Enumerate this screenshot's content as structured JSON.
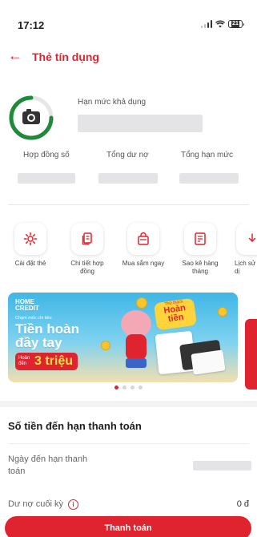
{
  "status": {
    "time": "17:12",
    "battery": "21"
  },
  "header": {
    "title": "Thẻ tín dụng"
  },
  "card_info": {
    "available_limit_label": "Hạn mức khả dụng",
    "contract_label": "Hợp đồng số",
    "total_debt_label": "Tổng dư nợ",
    "total_limit_label": "Tổng hạn mức"
  },
  "actions": [
    {
      "label": "Cài đặt thẻ"
    },
    {
      "label": "Chi tiết hợp đồng"
    },
    {
      "label": "Mua sắm ngay"
    },
    {
      "label": "Sao kê hàng tháng"
    },
    {
      "label": "Lịch sử dị"
    }
  ],
  "banner": {
    "brand_line1": "HOME",
    "brand_line2": "CREDIT",
    "subtitle": "Chạm mốc chi tiêu",
    "headline_1": "Tiền hoàn",
    "headline_2": "đầy tay",
    "pill_small": "Hoàn đến",
    "pill_big": "3 triệu",
    "badge_small": "Thử thách",
    "badge_big": "Hoàn tiền"
  },
  "due": {
    "title": "Số tiền đến hạn thanh toán",
    "due_date_label": "Ngày đến hạn thanh toán",
    "period_debt_label": "Dư nợ cuối kỳ",
    "period_debt_value": "0 đ"
  },
  "pay_button": "Thanh toán",
  "colors": {
    "accent": "#e0242f",
    "gauge": "#1f8a3a"
  }
}
